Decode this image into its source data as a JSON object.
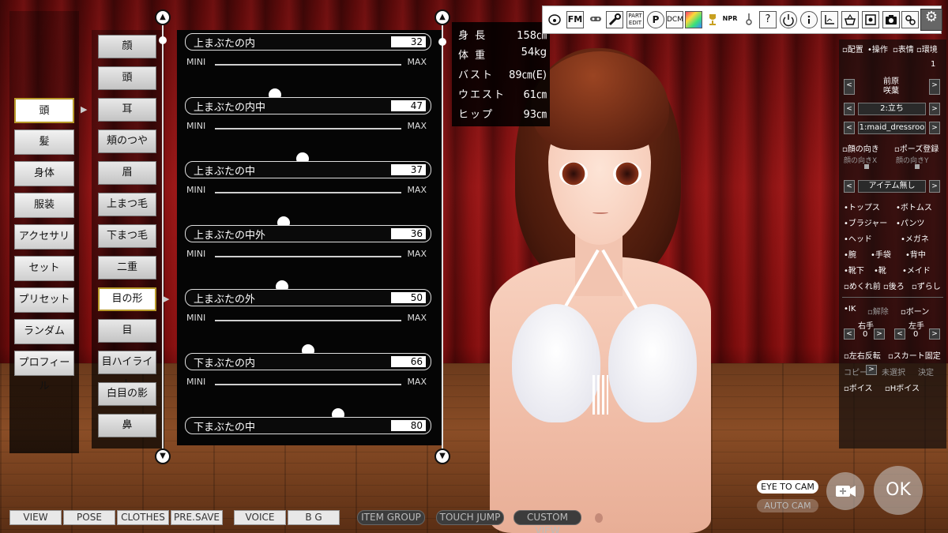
{
  "categories": [
    {
      "label": "頭",
      "selected": true
    },
    {
      "label": "髪"
    },
    {
      "label": "身体"
    },
    {
      "label": "服装"
    },
    {
      "label": "アクセサリ"
    },
    {
      "label": "セット"
    },
    {
      "label": "プリセット"
    },
    {
      "label": "ランダム"
    },
    {
      "label": "プロフィール"
    }
  ],
  "sub_categories": [
    {
      "label": "顔"
    },
    {
      "label": "頭"
    },
    {
      "label": "耳"
    },
    {
      "label": "頬のつや"
    },
    {
      "label": "眉"
    },
    {
      "label": "上まつ毛"
    },
    {
      "label": "下まつ毛"
    },
    {
      "label": "二重"
    },
    {
      "label": "目の形",
      "selected": true
    },
    {
      "label": "目"
    },
    {
      "label": "目ハイライト"
    },
    {
      "label": "白目の影"
    },
    {
      "label": "鼻"
    }
  ],
  "sliders": {
    "min_label": "MINI",
    "max_label": "MAX",
    "items": [
      {
        "name": "上まぶたの内",
        "value": "32",
        "level": 32
      },
      {
        "name": "上まぶたの内中",
        "value": "47",
        "level": 47
      },
      {
        "name": "上まぶたの中",
        "value": "37",
        "level": 37
      },
      {
        "name": "上まぶたの中外",
        "value": "36",
        "level": 36
      },
      {
        "name": "上まぶたの外",
        "value": "50",
        "level": 50
      },
      {
        "name": "下まぶたの内",
        "value": "66",
        "level": 66
      },
      {
        "name": "下まぶたの中",
        "value": "80",
        "level": 80
      }
    ]
  },
  "stats": [
    {
      "label": "身 長",
      "value": "158㎝"
    },
    {
      "label": "体 重",
      "value": "54kg"
    },
    {
      "label": "バスト",
      "value": "89㎝(E)"
    },
    {
      "label": "ウエスト",
      "value": "61㎝"
    },
    {
      "label": "ヒップ",
      "value": "93㎝"
    }
  ],
  "toolbar": {
    "fm": "FM",
    "part_edit": "PART EDIT",
    "p": "P",
    "dcm": "DCM",
    "npr": "NPR",
    "help": "?"
  },
  "right_panel": {
    "tabs": [
      "配置",
      "操作",
      "表情",
      "環境"
    ],
    "page_num": "1",
    "name_line1": "前原",
    "name_line2": "咲葉",
    "pose": "2:立ち",
    "clothes": "1:maid_dressroo",
    "face_dir": "顔の向き",
    "pose_reg": "ポーズ登録",
    "face_x": "顔の向きX",
    "face_y": "顔の向きY",
    "item": "アイテム無し",
    "parts": [
      "トップス",
      "ボトムス",
      "ブラジャー",
      "パンツ",
      "ヘッド",
      "メガネ",
      "腕",
      "手袋",
      "背中",
      "靴下",
      "靴",
      "メイド",
      "めくれ前",
      "後ろ",
      "ずらし"
    ],
    "ik": "IK",
    "release": "解除",
    "bone": "ボーン",
    "right_hand": "右手",
    "left_hand": "左手",
    "right_val": "0",
    "left_val": "0",
    "flip": "左右反転",
    "skirt": "スカート固定",
    "copy": "コピー",
    "unselected": "未選択",
    "decide": "決定",
    "pose_voice": "ボイス",
    "h_voice": "Hボイス"
  },
  "bottom_bar": [
    "VIEW",
    "POSE",
    "CLOTHES",
    "PRE.SAVE",
    "VOICE",
    "B G"
  ],
  "bottom_bar_dark": [
    "ITEM GROUP",
    "TOUCH JUMP",
    "CUSTOM VIEW"
  ],
  "camera": {
    "eye_to_cam": "EYE TO CAM",
    "auto_cam": "AUTO CAM",
    "ok": "OK"
  },
  "colors": {
    "selected_border": "#b89a2a",
    "curtain": "#8e1414",
    "floor": "#8a4d26"
  }
}
